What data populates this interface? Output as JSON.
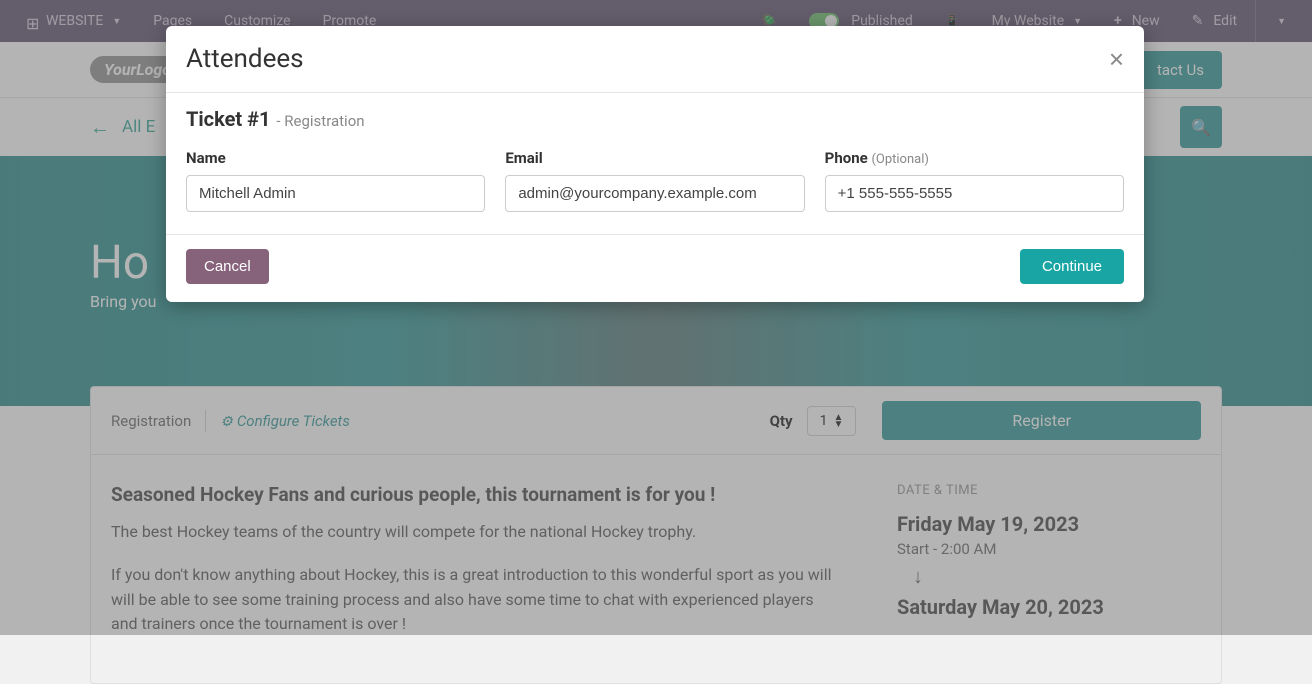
{
  "toolbar": {
    "website_label": "WEBSITE",
    "pages_label": "Pages",
    "customize_label": "Customize",
    "promote_label": "Promote",
    "published_label": "Published",
    "my_website_label": "My Website",
    "new_label": "New",
    "edit_label": "Edit"
  },
  "header": {
    "logo_text": "YourLogo",
    "contact_label": "tact Us"
  },
  "breadcrumb": {
    "back_label": "All E"
  },
  "hero": {
    "title": "Ho",
    "subtitle": "Bring you"
  },
  "registration": {
    "label": "Registration",
    "configure_label": "Configure Tickets",
    "qty_label": "Qty",
    "qty_value": "1",
    "register_label": "Register"
  },
  "content": {
    "headline": "Seasoned Hockey Fans and curious people, this tournament is for you !",
    "para1": "The best Hockey teams of the country will compete for the national Hockey trophy.",
    "para2": "If you don't know anything about Hockey, this is a great introduction to this wonderful sport as you will will be able to see some training process and also have some time to chat with experienced players and trainers once the tournament is over !"
  },
  "sidebar": {
    "datetime_label": "DATE & TIME",
    "start_date": "Friday May 19, 2023",
    "start_time": "Start - 2:00 AM",
    "end_date": "Saturday May 20, 2023"
  },
  "modal": {
    "title": "Attendees",
    "ticket_label": "Ticket #1",
    "ticket_sub": "- Registration",
    "name_label": "Name",
    "name_value": "Mitchell Admin",
    "email_label": "Email",
    "email_value": "admin@yourcompany.example.com",
    "phone_label": "Phone",
    "phone_optional": "(Optional)",
    "phone_value": "+1 555-555-5555",
    "cancel_label": "Cancel",
    "continue_label": "Continue"
  }
}
